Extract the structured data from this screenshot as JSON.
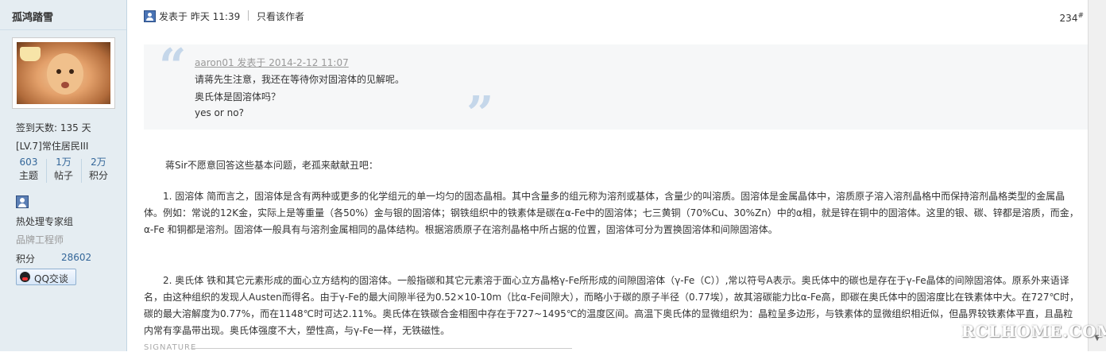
{
  "author": {
    "name": "孤鸿踏雪",
    "checkin": "签到天数: 135 天",
    "level": "[LV.7]常住居民III",
    "stats": [
      {
        "num": "603",
        "label": "主题"
      },
      {
        "num": "1万",
        "label": "帖子"
      },
      {
        "num": "2万",
        "label": "积分"
      }
    ],
    "group": "热处理专家组",
    "title": "品牌工程师",
    "points_label": "积分",
    "points_value": "28602",
    "qq_label": "QQ交谈"
  },
  "post": {
    "posted_at": "发表于 昨天 11:39",
    "only_author": "只看该作者",
    "floor": "234",
    "floor_mark": "#",
    "quote": {
      "author": "aaron01 发表于 2014-2-12 11:07",
      "lines": [
        "请蒋先生注意，我还在等待你对固溶体的见解呢。",
        "奥氏体是固溶体吗？",
        "yes or no?"
      ]
    },
    "intro": "蒋Sir不愿意回答这些基本问题，老孤来献献丑吧：",
    "para1": "1. 固溶体  简而言之，固溶体是含有两种或更多的化学组元的单一均匀的固态晶相。其中含量多的组元称为溶剂或基体，含量少的叫溶质。固溶体是金属晶体中，溶质原子溶入溶剂晶格中而保持溶剂晶格类型的金属晶体。例如：常说的12K金，实际上是等重量（各50%）金与银的固溶体；钢铁组织中的铁素体是碳在α-Fe中的固溶体；七三黄铜（70%Cu、30%Zn）中的α相，就是锌在铜中的固溶体。这里的银、碳、锌都是溶质，而金，α-Fe 和铜都是溶剂。固溶体一般具有与溶剂金属相同的晶体结构。根据溶质原子在溶剂晶格中所占据的位置，固溶体可分为置换固溶体和间隙固溶体。",
    "para2": "2. 奥氏体  铁和其它元素形成的面心立方结构的固溶体。一般指碳和其它元素溶于面心立方晶格γ-Fe所形成的间隙固溶体（γ-Fe（C））,常以符号A表示。奥氏体中的碳也是存在于γ-Fe晶体的间隙固溶体。原系外来语译名，由这种组织的发现人Austen而得名。由于γ-Fe的最大间隙半径为0.52×10-10m（比α-Fe间隙大），而略小于碳的原子半径（0.77埃），故其溶碳能力比α-Fe高，即碳在奥氏体中的固溶度比在铁素体中大。在727℃时，碳的最大溶解度为0.77%，而在1148℃时可达2.11%。奥氏体在铁碳合金相图中存在于727~1495℃的温度区间。高温下奥氏体的显微组织为：晶粒呈多边形，与铁素体的显微组织相近似，但晶界较铁素体平直，且晶粒内常有孪晶带出现。奥氏体强度不大，塑性高，与γ-Fe一样，无铁磁性。",
    "signature": "SIGNATURE"
  },
  "watermark": "RCLHOME.COM"
}
